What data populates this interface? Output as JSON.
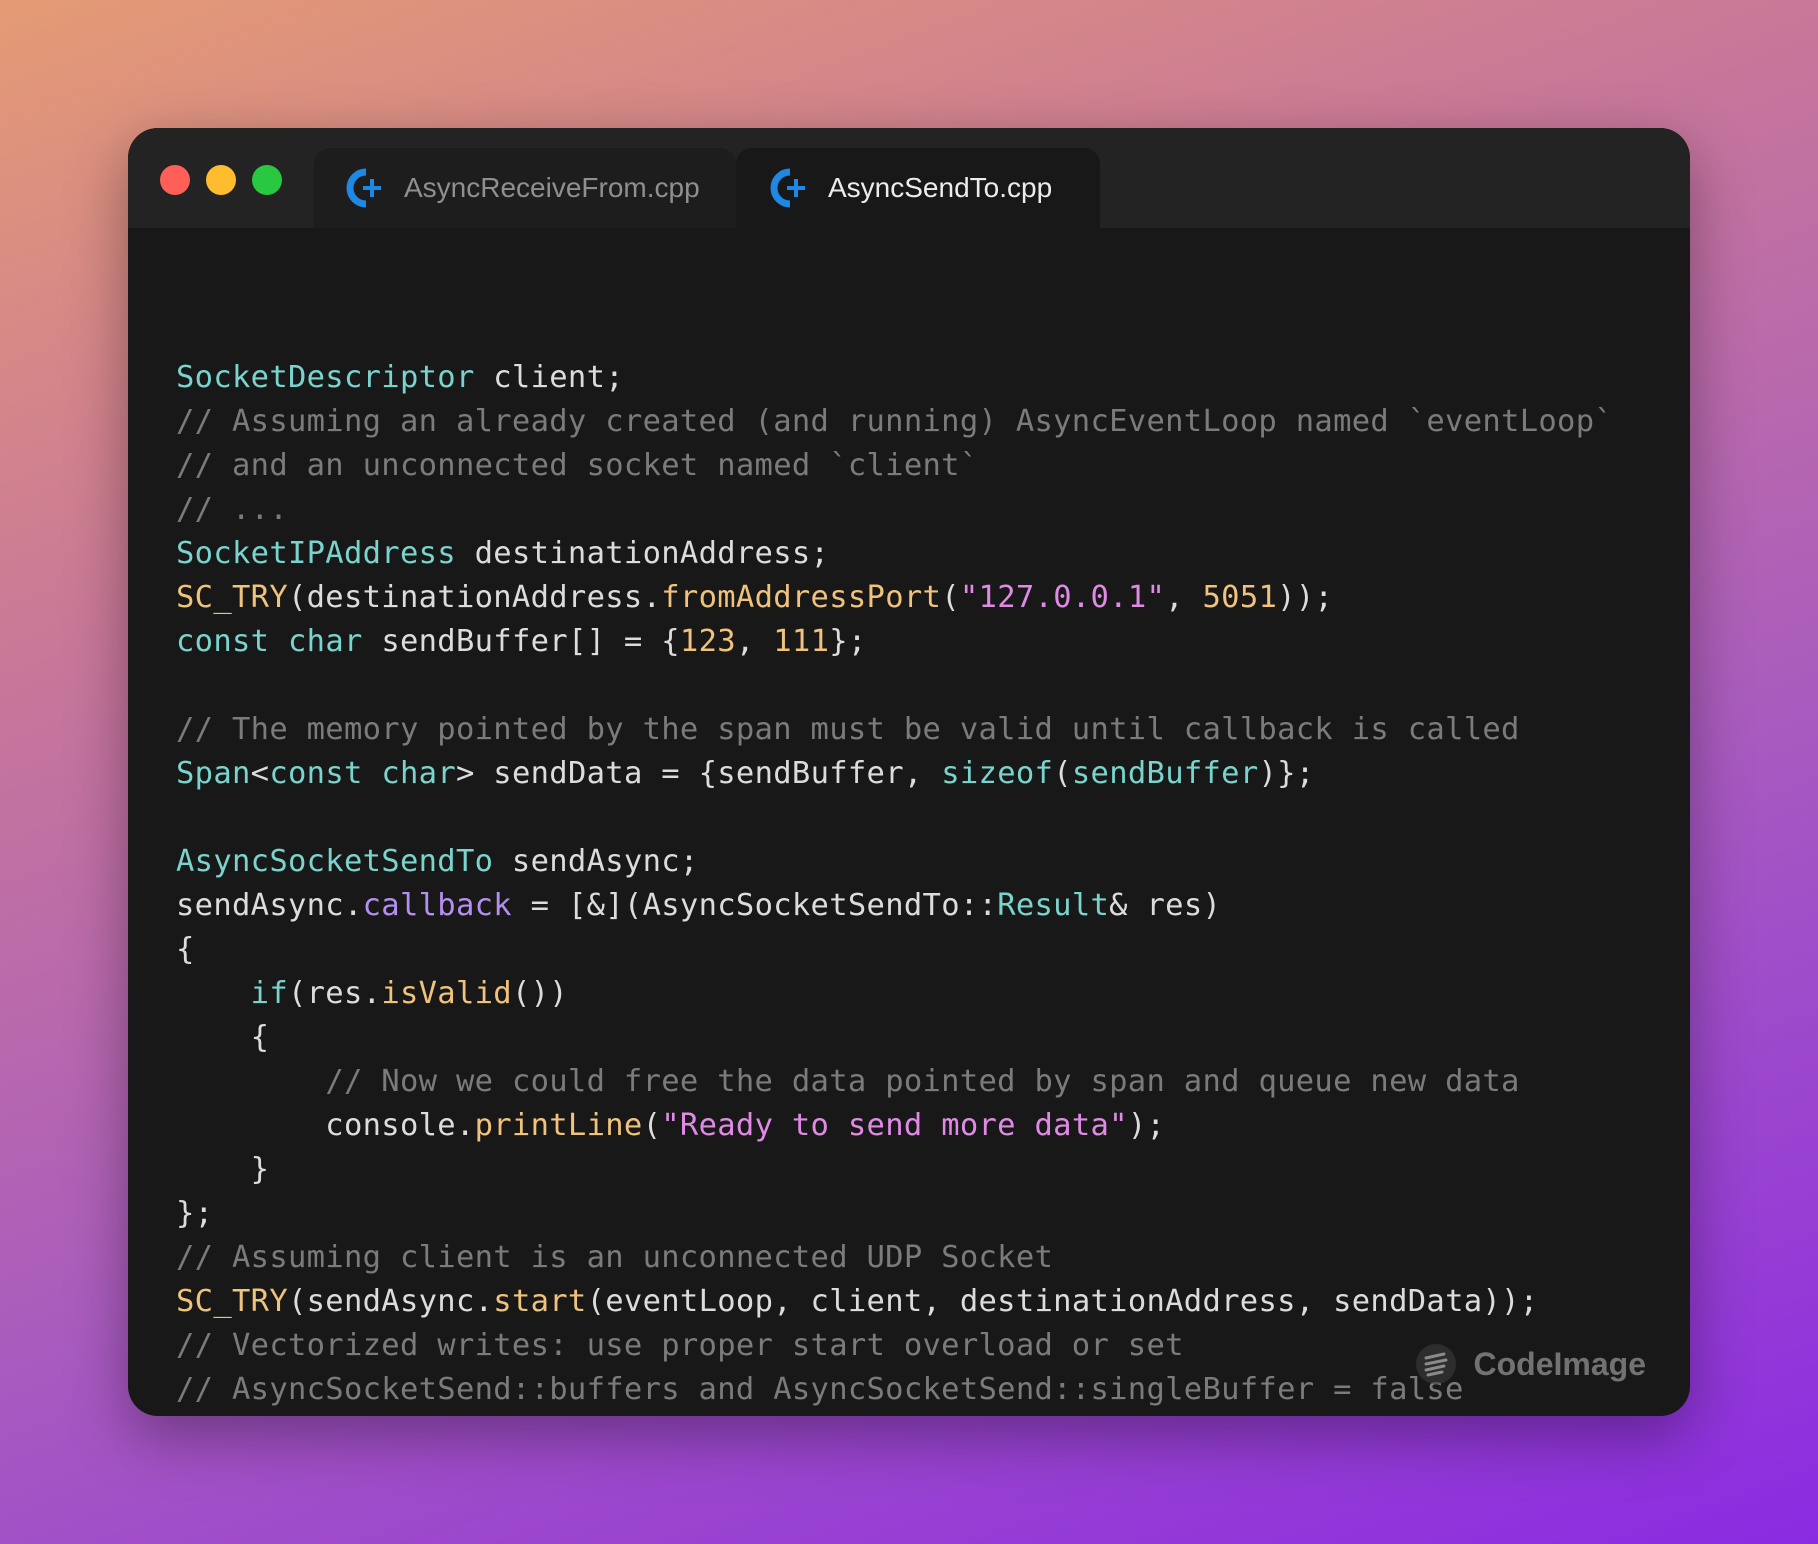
{
  "window": {
    "controls": [
      "close",
      "minimize",
      "maximize"
    ],
    "tabs": [
      {
        "label": "AsyncReceiveFrom.cpp",
        "icon": "cpp-icon",
        "active": false
      },
      {
        "label": "AsyncSendTo.cpp",
        "icon": "cpp-icon",
        "active": true
      }
    ]
  },
  "code": {
    "language": "cpp",
    "lines": [
      [],
      [
        {
          "t": "SocketDescriptor",
          "c": "type"
        },
        {
          "t": " client;",
          "c": "plain"
        }
      ],
      [
        {
          "t": "// Assuming an already created (and running) AsyncEventLoop named `eventLoop`",
          "c": "com"
        }
      ],
      [
        {
          "t": "// and an unconnected socket named `client`",
          "c": "com"
        }
      ],
      [
        {
          "t": "// ...",
          "c": "com"
        }
      ],
      [
        {
          "t": "SocketIPAddress",
          "c": "type"
        },
        {
          "t": " destinationAddress;",
          "c": "plain"
        }
      ],
      [
        {
          "t": "SC_TRY",
          "c": "fn"
        },
        {
          "t": "(destinationAddress.",
          "c": "plain"
        },
        {
          "t": "fromAddressPort",
          "c": "fn"
        },
        {
          "t": "(",
          "c": "plain"
        },
        {
          "t": "\"127.0.0.1\"",
          "c": "str"
        },
        {
          "t": ", ",
          "c": "plain"
        },
        {
          "t": "5051",
          "c": "num"
        },
        {
          "t": "));",
          "c": "plain"
        }
      ],
      [
        {
          "t": "const",
          "c": "kw"
        },
        {
          "t": " ",
          "c": "plain"
        },
        {
          "t": "char",
          "c": "kw"
        },
        {
          "t": " sendBuffer[] = {",
          "c": "plain"
        },
        {
          "t": "123",
          "c": "num"
        },
        {
          "t": ", ",
          "c": "plain"
        },
        {
          "t": "111",
          "c": "num"
        },
        {
          "t": "};",
          "c": "plain"
        }
      ],
      [],
      [
        {
          "t": "// The memory pointed by the span must be valid until callback is called",
          "c": "com"
        }
      ],
      [
        {
          "t": "Span",
          "c": "type"
        },
        {
          "t": "<",
          "c": "plain"
        },
        {
          "t": "const",
          "c": "kw"
        },
        {
          "t": " ",
          "c": "plain"
        },
        {
          "t": "char",
          "c": "kw"
        },
        {
          "t": "> sendData = {sendBuffer, ",
          "c": "plain"
        },
        {
          "t": "sizeof",
          "c": "kw"
        },
        {
          "t": "(",
          "c": "plain"
        },
        {
          "t": "sendBuffer",
          "c": "type"
        },
        {
          "t": ")};",
          "c": "plain"
        }
      ],
      [],
      [
        {
          "t": "AsyncSocketSendTo",
          "c": "type"
        },
        {
          "t": " sendAsync;",
          "c": "plain"
        }
      ],
      [
        {
          "t": "sendAsync.",
          "c": "plain"
        },
        {
          "t": "callback",
          "c": "prop"
        },
        {
          "t": " = [&](AsyncSocketSendTo::",
          "c": "plain"
        },
        {
          "t": "Result",
          "c": "type"
        },
        {
          "t": "& res)",
          "c": "plain"
        }
      ],
      [
        {
          "t": "{",
          "c": "plain"
        }
      ],
      [
        {
          "t": "    ",
          "c": "plain"
        },
        {
          "t": "if",
          "c": "kw"
        },
        {
          "t": "(res.",
          "c": "plain"
        },
        {
          "t": "isValid",
          "c": "fn"
        },
        {
          "t": "())",
          "c": "plain"
        }
      ],
      [
        {
          "t": "    {",
          "c": "plain"
        }
      ],
      [
        {
          "t": "        ",
          "c": "plain"
        },
        {
          "t": "// Now we could free the data pointed by span and queue new data",
          "c": "com"
        }
      ],
      [
        {
          "t": "        console.",
          "c": "plain"
        },
        {
          "t": "printLine",
          "c": "fn"
        },
        {
          "t": "(",
          "c": "plain"
        },
        {
          "t": "\"Ready to send more data\"",
          "c": "str"
        },
        {
          "t": ");",
          "c": "plain"
        }
      ],
      [
        {
          "t": "    }",
          "c": "plain"
        }
      ],
      [
        {
          "t": "};",
          "c": "plain"
        }
      ],
      [
        {
          "t": "// Assuming client is an unconnected UDP Socket",
          "c": "com"
        }
      ],
      [
        {
          "t": "SC_TRY",
          "c": "fn"
        },
        {
          "t": "(sendAsync.",
          "c": "plain"
        },
        {
          "t": "start",
          "c": "fn"
        },
        {
          "t": "(eventLoop, client, destinationAddress, sendData));",
          "c": "plain"
        }
      ],
      [
        {
          "t": "// Vectorized writes: use proper start overload or set",
          "c": "com"
        }
      ],
      [
        {
          "t": "// AsyncSocketSend::buffers and AsyncSocketSend::singleBuffer = false",
          "c": "com"
        }
      ]
    ]
  },
  "watermark": {
    "label": "CodeImage",
    "icon": "codeimage-logo-icon"
  },
  "colors": {
    "type": "#79d4cd",
    "keyword": "#79d4cd",
    "comment": "#7b7b7b",
    "function": "#f0c27b",
    "string": "#e08ae6",
    "number": "#f0c27b",
    "property": "#b48ef0",
    "plain": "#dcdcdc",
    "cpp_icon": "#1e88e5"
  }
}
